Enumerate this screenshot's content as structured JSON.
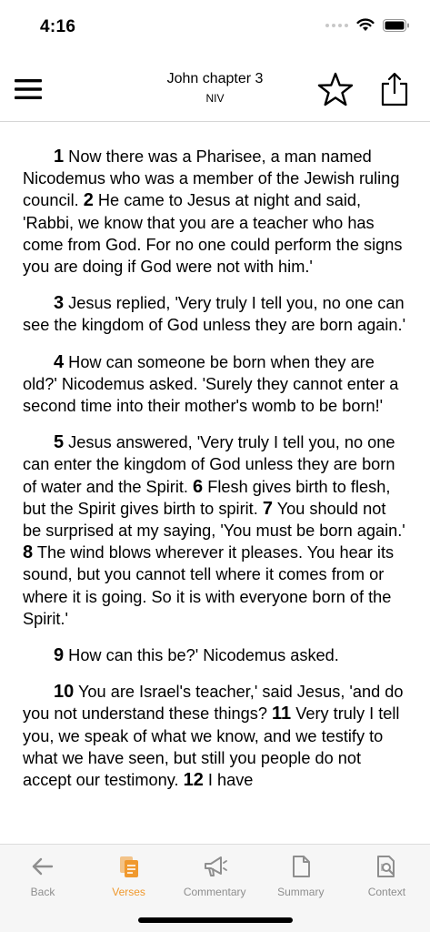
{
  "status": {
    "time": "4:16"
  },
  "header": {
    "title": "John chapter 3",
    "translation": "NIV"
  },
  "colors": {
    "accent": "#f0992e",
    "inactive": "#8e8e8e"
  },
  "verses": [
    {
      "parts": [
        {
          "n": "1",
          "t": " Now there was a Pharisee, a man named Nicodemus who was a member of the Jewish ruling council. "
        },
        {
          "n": "2",
          "t": " He came to Jesus at night and said, 'Rabbi, we know that you are a teacher who has come from God. For no one could perform the signs you are doing if God were not with him.'"
        }
      ]
    },
    {
      "parts": [
        {
          "n": "3",
          "t": " Jesus replied, 'Very truly I tell you, no one can see the kingdom of God unless they are born again.'"
        }
      ]
    },
    {
      "parts": [
        {
          "n": "4",
          "t": " How can someone be born when they are old?' Nicodemus asked. 'Surely they cannot enter a second time into their mother's womb to be born!'"
        }
      ]
    },
    {
      "parts": [
        {
          "n": "5",
          "t": " Jesus answered, 'Very truly I tell you, no one can enter the kingdom of God unless they are born of water and the Spirit. "
        },
        {
          "n": "6",
          "t": " Flesh gives birth to flesh, but the Spirit gives birth to spirit. "
        },
        {
          "n": "7",
          "t": " You should not be surprised at my saying, 'You must be born again.' "
        },
        {
          "n": "8",
          "t": " The wind blows wherever it pleases. You hear its sound, but you cannot tell where it comes from or where it is going. So it is with everyone born of the Spirit.'"
        }
      ]
    },
    {
      "parts": [
        {
          "n": "9",
          "t": " How can this be?' Nicodemus asked."
        }
      ]
    },
    {
      "parts": [
        {
          "n": "10",
          "t": " You are Israel's teacher,' said Jesus, 'and do you not understand these things? "
        },
        {
          "n": "11",
          "t": " Very truly I tell you, we speak of what we know, and we testify to what we have seen, but still you people do not accept our testimony. "
        },
        {
          "n": "12",
          "t": " I have"
        }
      ]
    }
  ],
  "tabs": [
    {
      "label": "Back",
      "icon": "back-arrow-icon",
      "active": false
    },
    {
      "label": "Verses",
      "icon": "verses-icon",
      "active": true
    },
    {
      "label": "Commentary",
      "icon": "megaphone-icon",
      "active": false
    },
    {
      "label": "Summary",
      "icon": "document-icon",
      "active": false
    },
    {
      "label": "Context",
      "icon": "context-search-icon",
      "active": false
    }
  ]
}
